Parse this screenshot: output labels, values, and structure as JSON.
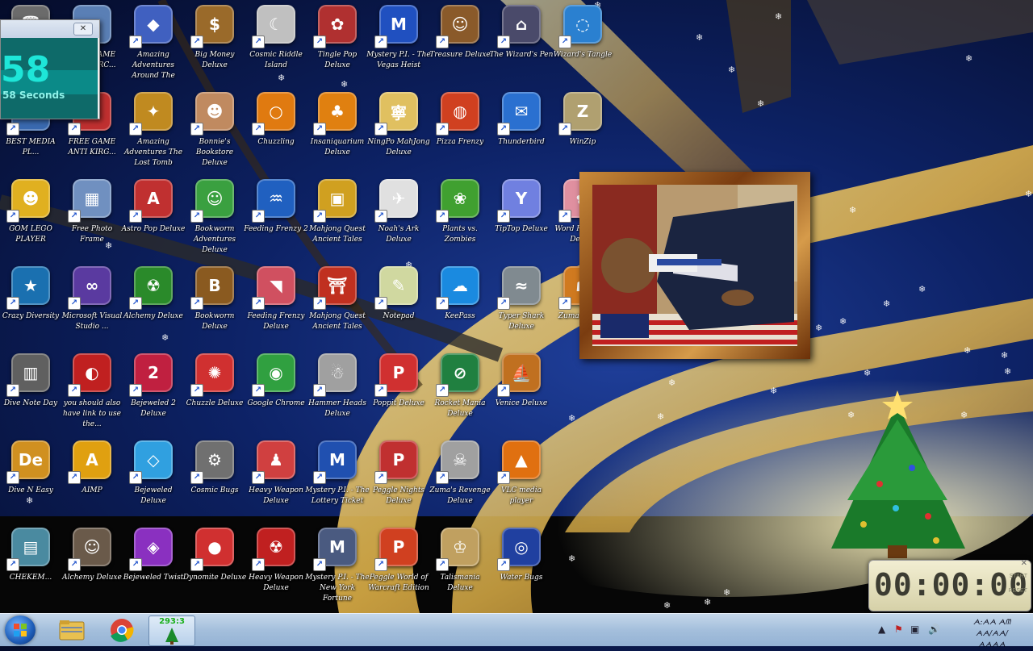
{
  "desktop_icons": [
    {
      "label": "",
      "color": "#6b6b6b",
      "glyph": "🗑"
    },
    {
      "label": "FREE CAME ANTI KIRC...",
      "color": "#5a7fb5",
      "glyph": "▤"
    },
    {
      "label": "Amazing Adventures Around The World",
      "color": "#4060c0",
      "glyph": "◆"
    },
    {
      "label": "Big Money Deluxe",
      "color": "#9a6a2a",
      "glyph": "$"
    },
    {
      "label": "Cosmic Riddle Island",
      "color": "#c0c0c0",
      "glyph": "☾"
    },
    {
      "label": "Tingle Pop Deluxe",
      "color": "#b03030",
      "glyph": "✿"
    },
    {
      "label": "Mystery P.I. - The Vegas Heist",
      "color": "#2050c0",
      "glyph": "M"
    },
    {
      "label": "Treasure Deluxe",
      "color": "#8a5a2a",
      "glyph": "☺"
    },
    {
      "label": "The Wizard's Pen",
      "color": "#4a4a6a",
      "glyph": "⌂"
    },
    {
      "label": "Wizard's Tangle",
      "color": "#2a80d0",
      "glyph": "◌"
    },
    {
      "label": "BEST MEDIA PL...",
      "color": "#3a6ab0",
      "glyph": "▶"
    },
    {
      "label": "FREE GAME ANTI KIRG...",
      "color": "#c03030",
      "glyph": "●"
    },
    {
      "label": "Amazing Adventures The Lost Tomb",
      "color": "#c08a20",
      "glyph": "✦"
    },
    {
      "label": "Bonnie's Bookstore Deluxe",
      "color": "#c08a60",
      "glyph": "☻"
    },
    {
      "label": "Chuzzling",
      "color": "#e07a10",
      "glyph": "○"
    },
    {
      "label": "Insaniquarium Deluxe",
      "color": "#e08010",
      "glyph": "♣"
    },
    {
      "label": "NingPo MahJong Deluxe",
      "color": "#e0c060",
      "glyph": "寧"
    },
    {
      "label": "Pizza Frenzy",
      "color": "#d04020",
      "glyph": "◍"
    },
    {
      "label": "Thunderbird",
      "color": "#2a70d0",
      "glyph": "✉"
    },
    {
      "label": "WinZip",
      "color": "#b0a070",
      "glyph": "Z"
    },
    {
      "label": "GOM LEGO PLAYER",
      "color": "#e0b020",
      "glyph": "☻"
    },
    {
      "label": "Free Photo Frame",
      "color": "#7090c0",
      "glyph": "▦"
    },
    {
      "label": "Astro Pop Deluxe",
      "color": "#c03030",
      "glyph": "A"
    },
    {
      "label": "Bookworm Adventures Deluxe",
      "color": "#3aa040",
      "glyph": "☺"
    },
    {
      "label": "Feeding Frenzy 2",
      "color": "#2060c0",
      "glyph": "♒"
    },
    {
      "label": "Mahjong Quest Ancient Tales",
      "color": "#d0a020",
      "glyph": "▣"
    },
    {
      "label": "Noah's Ark Deluxe",
      "color": "#e0e0e0",
      "glyph": "✈"
    },
    {
      "label": "Plants vs. Zombies",
      "color": "#40a030",
      "glyph": "❀"
    },
    {
      "label": "TipTop Deluxe",
      "color": "#7080e0",
      "glyph": "Y"
    },
    {
      "label": "Word Harmony Deluxe",
      "color": "#e090a0",
      "glyph": "✿"
    },
    {
      "label": "Crazy Diversity",
      "color": "#1a70b0",
      "glyph": "★"
    },
    {
      "label": "Microsoft Visual Studio ...",
      "color": "#5a3aa0",
      "glyph": "∞"
    },
    {
      "label": "Alchemy Deluxe",
      "color": "#2a8a2a",
      "glyph": "☢"
    },
    {
      "label": "Bookworm Deluxe",
      "color": "#8a5a20",
      "glyph": "B"
    },
    {
      "label": "Feeding Frenzy Deluxe",
      "color": "#d05060",
      "glyph": "◥"
    },
    {
      "label": "Mahjong Quest Ancient Tales",
      "color": "#c03020",
      "glyph": "⛩"
    },
    {
      "label": "Notepad",
      "color": "#d0d8a0",
      "glyph": "✎"
    },
    {
      "label": "KeePass",
      "color": "#1a8ae0",
      "glyph": "☁"
    },
    {
      "label": "Typer Shark Deluxe",
      "color": "#808a90",
      "glyph": "≈"
    },
    {
      "label": "Zuma Deluxe",
      "color": "#d07a20",
      "glyph": "☗"
    },
    {
      "label": "Dive Note Day",
      "color": "#606060",
      "glyph": "▥"
    },
    {
      "label": "you should also have link to use the...",
      "color": "#c02020",
      "glyph": "◐"
    },
    {
      "label": "Bejeweled 2 Deluxe",
      "color": "#c02040",
      "glyph": "2"
    },
    {
      "label": "Chuzzle Deluxe",
      "color": "#d03030",
      "glyph": "✺"
    },
    {
      "label": "Google Chrome",
      "color": "#30a040",
      "glyph": "◉"
    },
    {
      "label": "Hammer Heads Deluxe",
      "color": "#a0a0a0",
      "glyph": "☃"
    },
    {
      "label": "Poppit Deluxe",
      "color": "#d03030",
      "glyph": "P"
    },
    {
      "label": "Rocket Mania Deluxe",
      "color": "#208040",
      "glyph": "⊘"
    },
    {
      "label": "Venice Deluxe",
      "color": "#c07020",
      "glyph": "⛵"
    },
    {
      "label": "Dive N Easy",
      "color": "#d09020",
      "glyph": "De"
    },
    {
      "label": "AIMP",
      "color": "#e0a010",
      "glyph": "A"
    },
    {
      "label": "Bejeweled Deluxe",
      "color": "#30a0e0",
      "glyph": "◇"
    },
    {
      "label": "Cosmic Bugs",
      "color": "#707070",
      "glyph": "⚙"
    },
    {
      "label": "Heavy Weapon Deluxe",
      "color": "#d04040",
      "glyph": "♟"
    },
    {
      "label": "Mystery P.I. - The Lottery Ticket",
      "color": "#2050b0",
      "glyph": "M"
    },
    {
      "label": "Peggle Nights Deluxe",
      "color": "#c03030",
      "glyph": "P"
    },
    {
      "label": "Zuma's Revenge Deluxe",
      "color": "#a0a0a0",
      "glyph": "☠"
    },
    {
      "label": "VLC media player",
      "color": "#e07010",
      "glyph": "▲"
    },
    {
      "label": "CHEKEM...",
      "color": "#4a8aa0",
      "glyph": "▤"
    },
    {
      "label": "Alchemy Deluxe",
      "color": "#6a5a4a",
      "glyph": "☺"
    },
    {
      "label": "Bejeweled Twist",
      "color": "#8a30c0",
      "glyph": "◈"
    },
    {
      "label": "Dynomite Deluxe",
      "color": "#d03030",
      "glyph": "●"
    },
    {
      "label": "Heavy Weapon Deluxe",
      "color": "#c02020",
      "glyph": "☢"
    },
    {
      "label": "Mystery P.I. - The New York Fortune",
      "color": "#4a5a80",
      "glyph": "M"
    },
    {
      "label": "Peggle World of Warcraft Edition",
      "color": "#d04020",
      "glyph": "P"
    },
    {
      "label": "Talismania Deluxe",
      "color": "#c0a060",
      "glyph": "♔"
    },
    {
      "label": "Water Bugs",
      "color": "#2040a0",
      "glyph": "◎"
    }
  ],
  "countdown_widget": {
    "close_label": "✕",
    "big_number": "58",
    "small_text": "58 Seconds"
  },
  "timer_widget": {
    "digits": "00:00:00",
    "start_label": "START",
    "reset_label": "RESET"
  },
  "taskbar": {
    "active_counter": "293:3",
    "clock_time": "ᗅ:ᗅᗅ ᗅᗰ",
    "clock_date": "ᗅᗅ/ᗅᗅ/ᗅᗅᗅᗅ"
  },
  "colors": {
    "taskbar_bg": "#a4bfdc",
    "counter_text": "#1ab01a"
  }
}
